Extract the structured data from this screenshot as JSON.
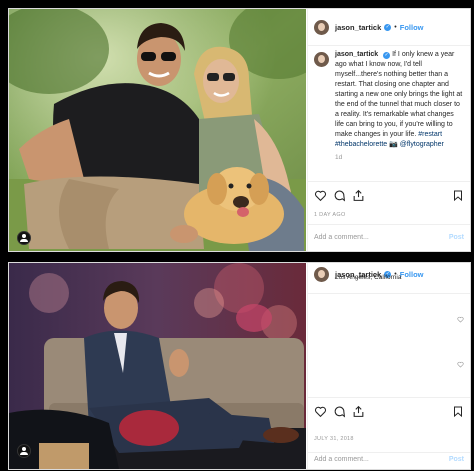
{
  "post1": {
    "username": "jason_tartick",
    "follow_label": "Follow",
    "caption_user": "jason_tartick",
    "caption_text": "If I only knew a year ago what I know now, I'd tell myself...there's nothing better than a restart. That closing one chapter and starting a new one only brings the light at the end of the tunnel that much closer to a reality. It's remarkable what changes life can bring to you, if you're willing to make changes in your life.",
    "hashtags": "#restart #thebachelorette",
    "emoji": "📷",
    "mention": "@flytographer",
    "time_ago": "1d",
    "date": "1 DAY AGO",
    "comment_placeholder": "Add a comment...",
    "post_label": "Post"
  },
  "post2": {
    "username": "jason_tartick",
    "follow_label": "Follow",
    "location": "Los Angeles, California",
    "date": "JULY 31, 2018",
    "comment_placeholder": "Add a comment...",
    "post_label": "Post"
  },
  "colors": {
    "link_blue": "#3897f0",
    "hashtag_navy": "#003569",
    "muted_gray": "#999999"
  },
  "icons": [
    "heart-icon",
    "comment-icon",
    "share-icon",
    "bookmark-icon",
    "user-tag-icon",
    "verified-badge-icon",
    "small-heart-icon"
  ]
}
